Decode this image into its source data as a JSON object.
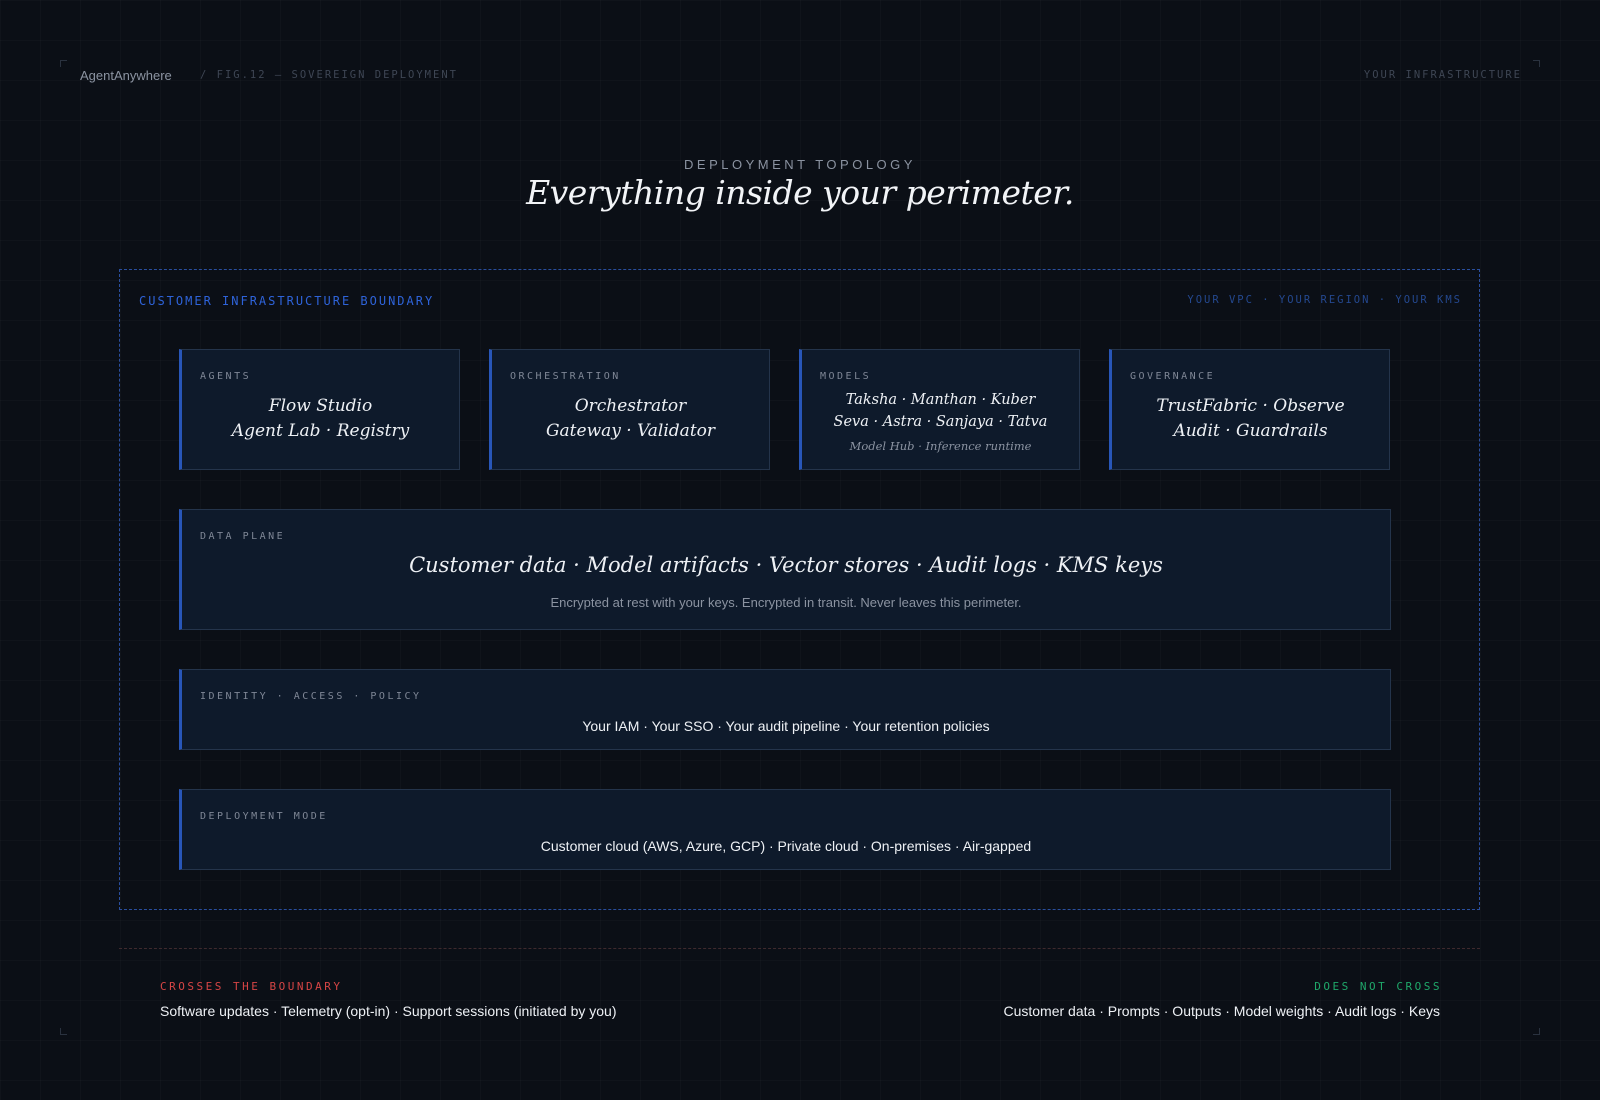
{
  "header": {
    "brand": "AgentAnywhere",
    "figure_label": "/ FIG.12 — SOVEREIGN DEPLOYMENT",
    "right_label": "YOUR INFRASTRUCTURE"
  },
  "intro": {
    "eyebrow": "DEPLOYMENT TOPOLOGY",
    "headline": "Everything inside your perimeter."
  },
  "boundary": {
    "label": "CUSTOMER INFRASTRUCTURE BOUNDARY",
    "meta": "YOUR VPC · YOUR REGION · YOUR KMS"
  },
  "components": [
    {
      "label": "AGENTS",
      "lines": [
        "Flow Studio",
        "Agent Lab · Registry"
      ]
    },
    {
      "label": "ORCHESTRATION",
      "lines": [
        "Orchestrator",
        "Gateway · Validator"
      ]
    },
    {
      "label": "MODELS",
      "lines": [
        "Taksha · Manthan · Kuber",
        "Seva · Astra · Sanjaya · Tatva"
      ],
      "sub": "Model Hub · Inference runtime"
    },
    {
      "label": "GOVERNANCE",
      "lines": [
        "TrustFabric · Observe",
        "Audit · Guardrails"
      ]
    }
  ],
  "data_plane": {
    "label": "DATA PLANE",
    "title": "Customer data · Model artifacts · Vector stores · Audit logs · KMS keys",
    "note": "Encrypted at rest with your keys. Encrypted in transit. Never leaves this perimeter."
  },
  "identity": {
    "label": "IDENTITY · ACCESS · POLICY",
    "text": "Your IAM · Your SSO · Your audit pipeline · Your retention policies"
  },
  "deployment": {
    "label": "DEPLOYMENT MODE",
    "text": "Customer cloud (AWS, Azure, GCP) · Private cloud · On-premises · Air-gapped"
  },
  "crosses": {
    "label": "CROSSES THE BOUNDARY",
    "text": "Software updates · Telemetry (opt-in) · Support sessions (initiated by you)"
  },
  "not_cross": {
    "label": "DOES NOT CROSS",
    "text": "Customer data · Prompts · Outputs · Model weights · Audit logs · Keys"
  },
  "colors": {
    "background": "#0b0f16",
    "accent_blue": "#2e63d9",
    "crosses_red": "#d64545",
    "does_not_cross_green": "#1fa86a"
  }
}
